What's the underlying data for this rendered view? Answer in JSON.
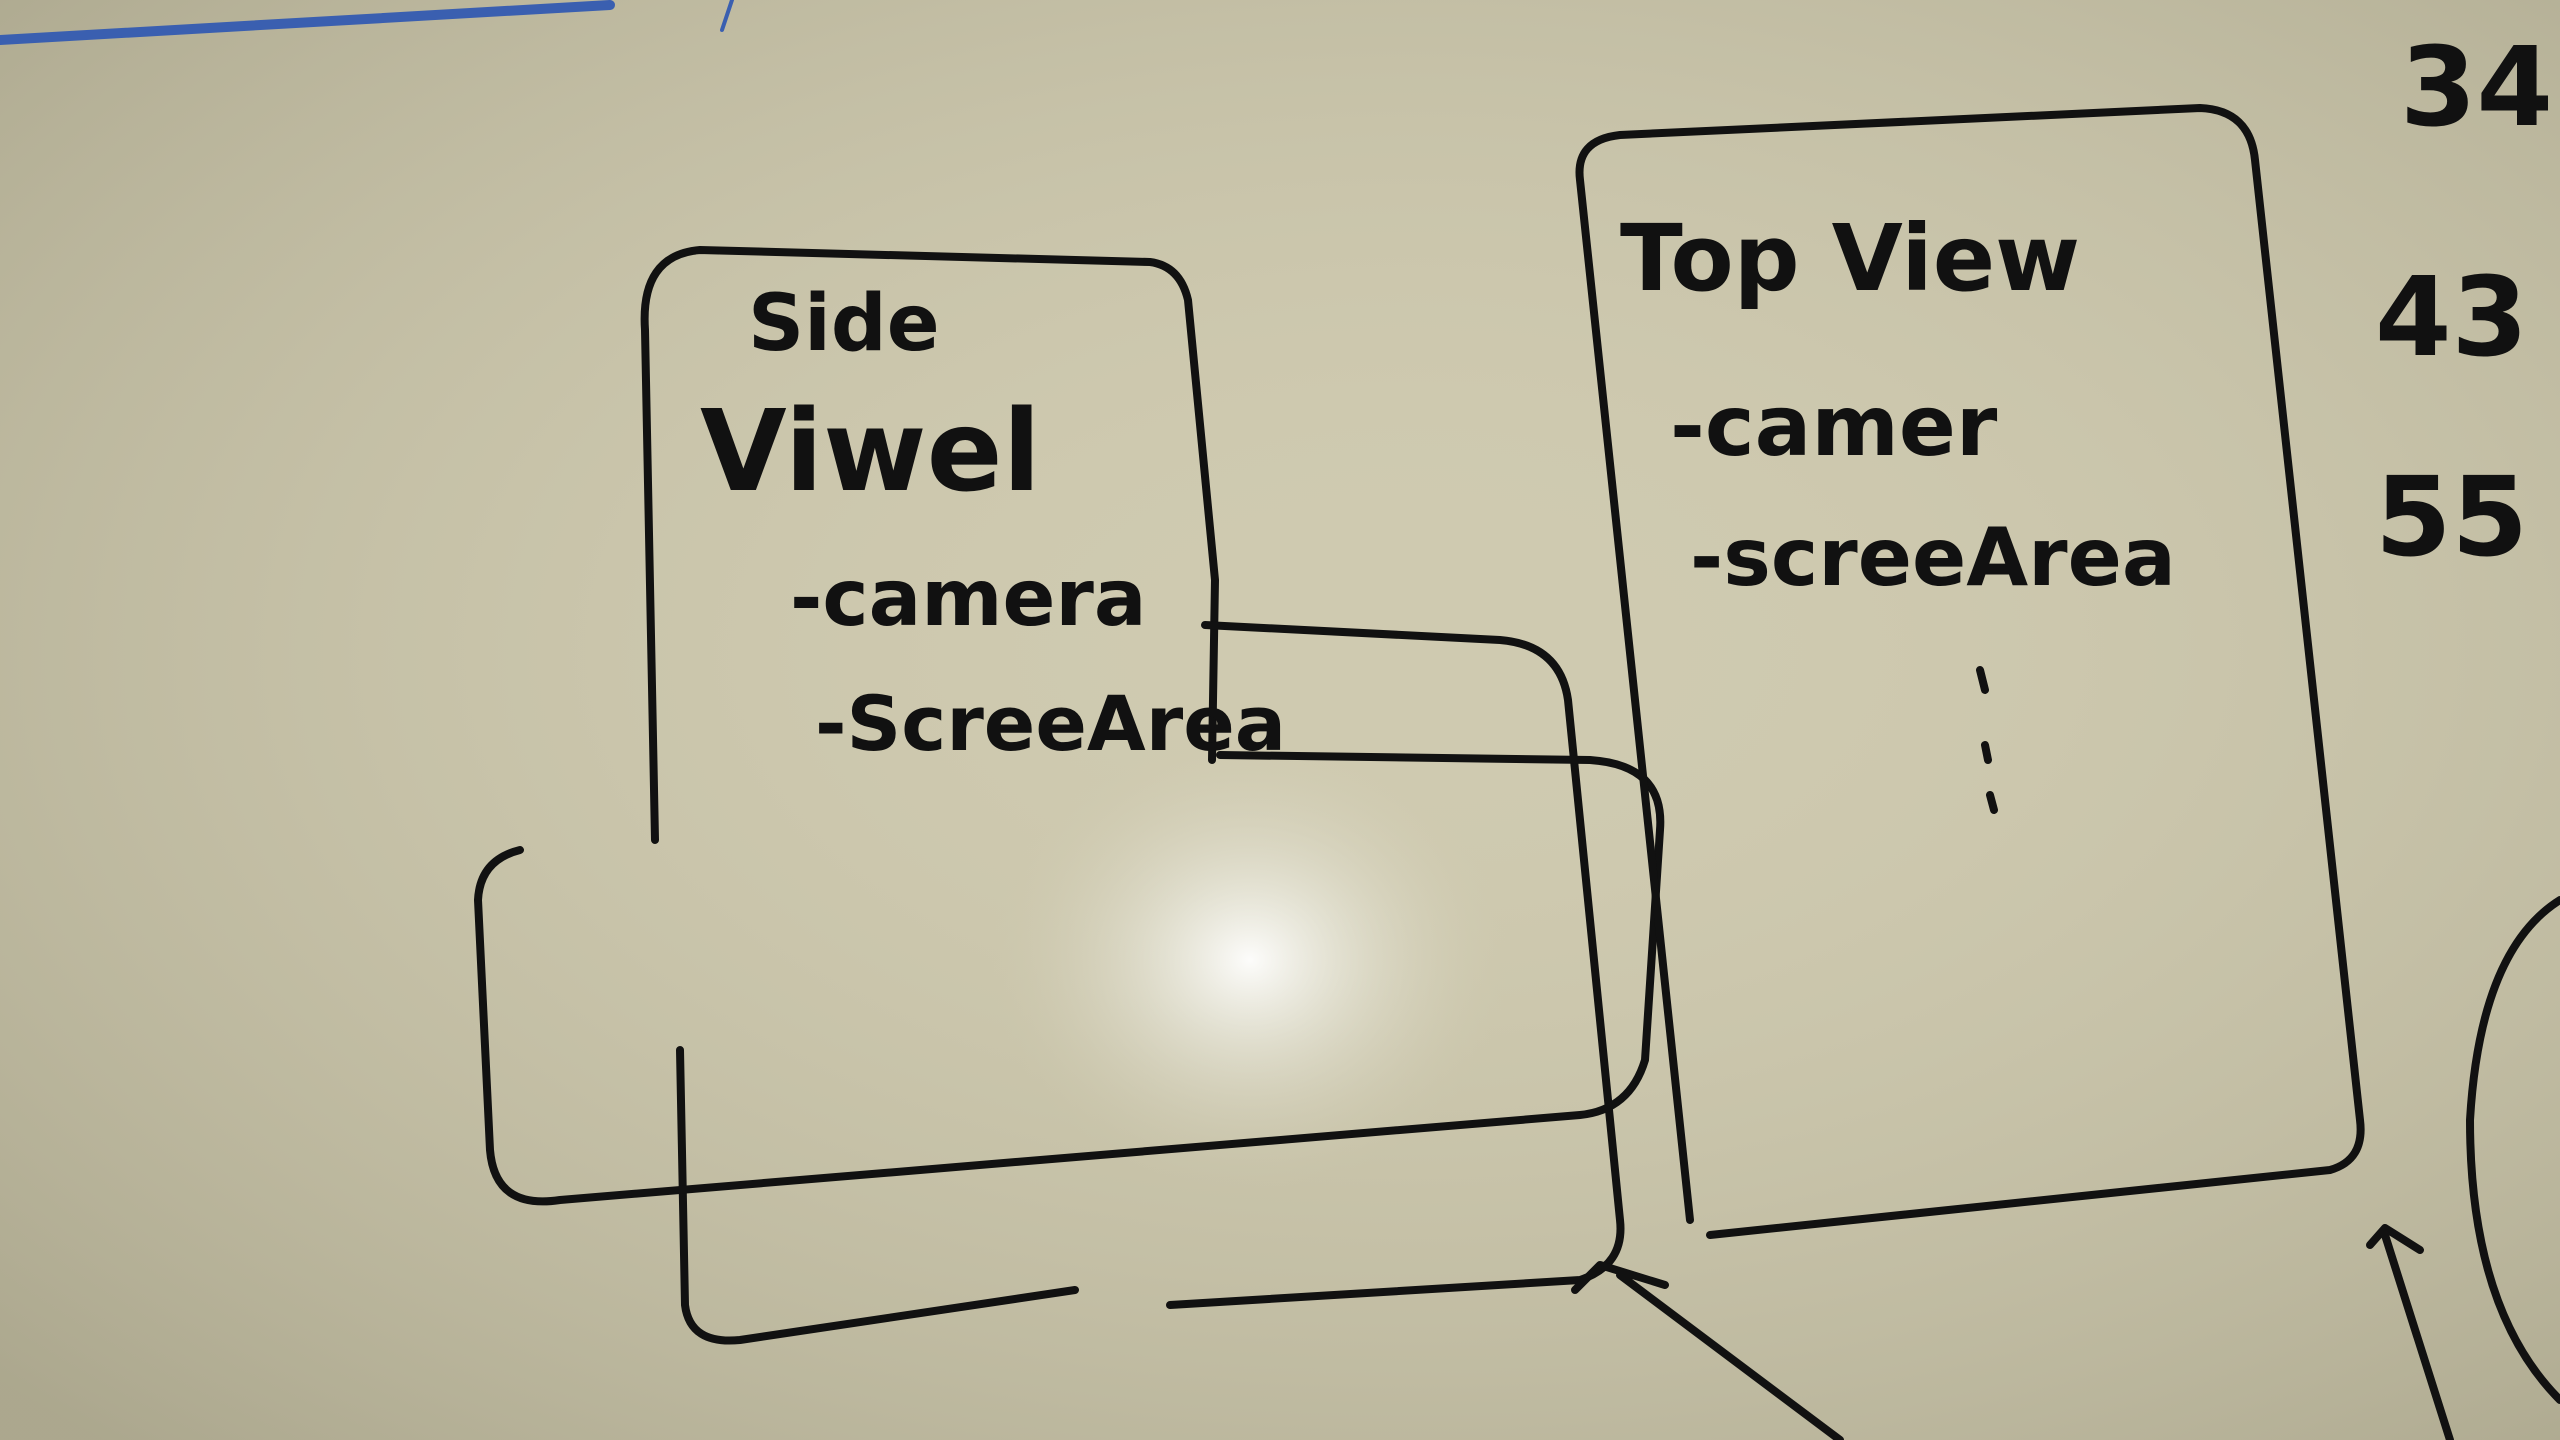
{
  "board": {
    "background": "#cfcab0",
    "ink_color": "#111111",
    "accent_color": "#3a5fb0"
  },
  "side_panel": {
    "title_line1": "Side",
    "title_line2": "Viwel",
    "items": [
      "-camera",
      "-ScreeArea"
    ]
  },
  "top_panel": {
    "title": "Top View",
    "items": [
      "-camer",
      "-screeArea"
    ],
    "ellipsis": ":"
  },
  "numbers": [
    "34",
    "43",
    "55"
  ]
}
